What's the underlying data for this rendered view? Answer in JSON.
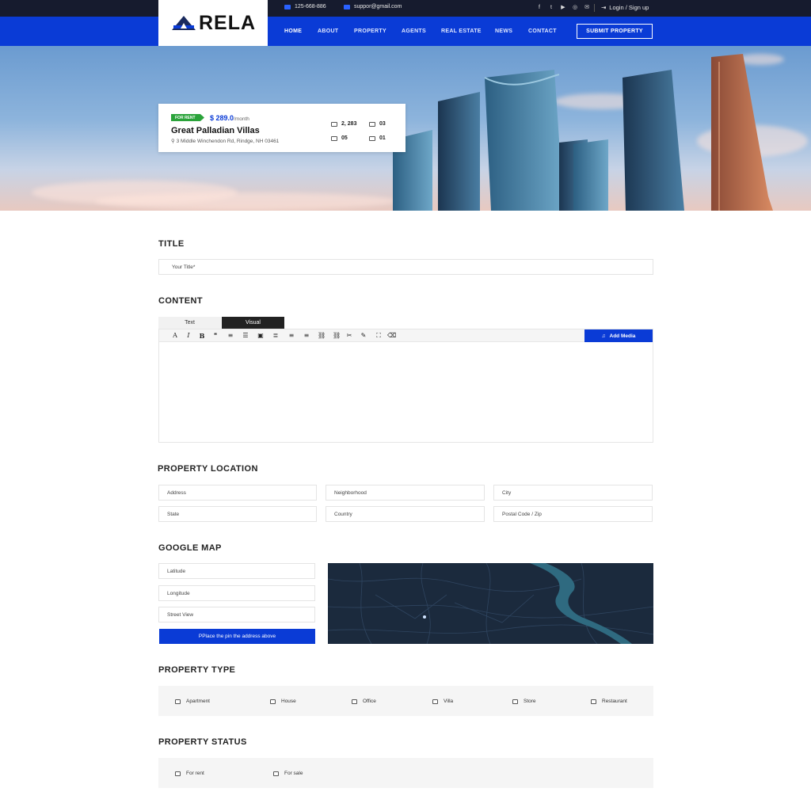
{
  "brand": {
    "logo_text": "RELA"
  },
  "topbar": {
    "phone": "125-668-886",
    "email": "suppor@gmail.com",
    "social_icons": [
      "facebook-icon",
      "twitter-icon",
      "youtube-icon",
      "instagram-icon",
      "mail-icon"
    ],
    "login_label": "Login / Sign up"
  },
  "nav": {
    "items": [
      {
        "label": "HOME",
        "active": true
      },
      {
        "label": "ABOUT"
      },
      {
        "label": "PROPERTY"
      },
      {
        "label": "AGENTS"
      },
      {
        "label": "REAL ESTATE"
      },
      {
        "label": "NEWS"
      },
      {
        "label": "CONTACT"
      }
    ],
    "submit_label": "SUBMIT PROPERTY"
  },
  "hero_card": {
    "badge": "FOR RENT",
    "price": "$ 289.0",
    "price_unit": "/month",
    "title": "Great Palladian Villas",
    "address": "3 Middle Winchendon Rd, Rindge, NH 03461",
    "area": "2, 283",
    "bathrooms": "03",
    "bedrooms": "05",
    "garages": "01"
  },
  "form": {
    "title_section": "TITLE",
    "title_placeholder": "Your Title*",
    "content_section": "CONTENT",
    "tab_text": "Text",
    "tab_visual": "Visual",
    "add_media": "Add Media",
    "toolbar_icons": [
      "A",
      "I",
      "B",
      "❝",
      "≡",
      "☰",
      "▣",
      "≣",
      "≡",
      "≡",
      "⛓",
      "⛓",
      "✂",
      "✎",
      "⛶",
      "⌫"
    ],
    "location_section": "PROPERTY LOCATION",
    "address_placeholder": "Address",
    "neighborhood_placeholder": "Neighborhood",
    "city_placeholder": "City",
    "state_placeholder": "State",
    "country_placeholder": "Country",
    "postal_placeholder": "Postal Code / Zip",
    "map_section": "GOOGLE MAP",
    "latitude_placeholder": "Latitude",
    "longitude_placeholder": "Longitude",
    "streetview_placeholder": "Street View",
    "pin_button": "PPlace the pin the address above",
    "type_section": "PROPERTY TYPE",
    "types": [
      "Apartment",
      "House",
      "Office",
      "Villa",
      "Store",
      "Restaurant"
    ],
    "status_section": "PROPERTY STATUS",
    "statuses": [
      "For rent",
      "For sale"
    ]
  },
  "colors": {
    "brand_blue": "#0a3bd6",
    "topbar_dark": "#161b2e",
    "badge_green": "#2aa33a"
  }
}
